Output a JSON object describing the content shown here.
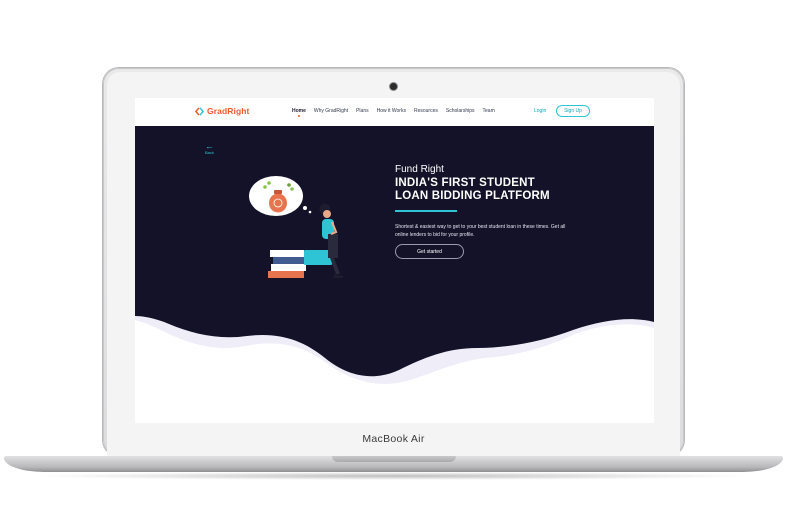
{
  "device": {
    "brand_label": "MacBook Air"
  },
  "header": {
    "logo_text": "GradRight",
    "nav": [
      "Home",
      "Why GradRight",
      "Plans",
      "How it Works",
      "Resources",
      "Scholarships",
      "Team"
    ],
    "active_nav": "Home",
    "login_label": "Login",
    "signup_label": "Sign Up"
  },
  "hero": {
    "back_label": "Back",
    "eyebrow": "Fund Right",
    "headline_line1": "INDIA'S FIRST STUDENT",
    "headline_line2": "LOAN BIDDING PLATFORM",
    "description": "Shortest & easiest way to get to your best student loan in these times. Get all online lenders to bid for your profile.",
    "cta_label": "Get started"
  },
  "colors": {
    "brand_orange": "#f15a29",
    "accent_teal": "#2ec4d6",
    "hero_background": "#141229",
    "wave_light": "#efeef8"
  }
}
